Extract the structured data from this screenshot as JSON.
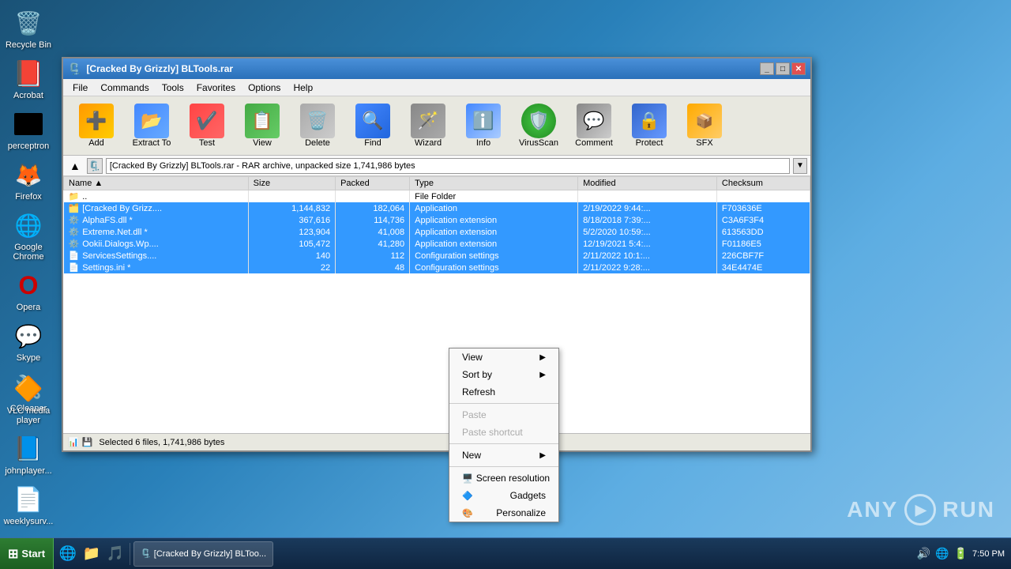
{
  "desktop": {
    "icons": [
      {
        "id": "recycle-bin",
        "label": "Recycle Bin",
        "icon": "🗑️"
      },
      {
        "id": "acrobat",
        "label": "Acrobat",
        "icon": "📄"
      },
      {
        "id": "black-box",
        "label": "perceptron",
        "icon": ""
      },
      {
        "id": "firefox",
        "label": "Firefox",
        "icon": "🦊"
      },
      {
        "id": "chrome",
        "label": "Google Chrome",
        "icon": "🌐"
      },
      {
        "id": "opera",
        "label": "Opera",
        "icon": "O"
      },
      {
        "id": "skype",
        "label": "Skype",
        "icon": "💬"
      },
      {
        "id": "ccleaner",
        "label": "CCleaner",
        "icon": "🔧"
      }
    ],
    "bottom_icons": [
      {
        "id": "vlc",
        "label": "VLC media player",
        "icon": "🔶"
      },
      {
        "id": "word1",
        "label": "johnplayer...",
        "icon": "📝"
      },
      {
        "id": "word2",
        "label": "weeklysurv...",
        "icon": "📄"
      }
    ]
  },
  "winrar": {
    "title": "[Cracked By Grizzly] BLTools.rar",
    "menu": [
      "File",
      "Commands",
      "Tools",
      "Favorites",
      "Options",
      "Help"
    ],
    "toolbar": [
      {
        "id": "add",
        "label": "Add"
      },
      {
        "id": "extract-to",
        "label": "Extract To"
      },
      {
        "id": "test",
        "label": "Test"
      },
      {
        "id": "view",
        "label": "View"
      },
      {
        "id": "delete",
        "label": "Delete"
      },
      {
        "id": "find",
        "label": "Find"
      },
      {
        "id": "wizard",
        "label": "Wizard"
      },
      {
        "id": "info",
        "label": "Info"
      },
      {
        "id": "virusscan",
        "label": "VirusScan"
      },
      {
        "id": "comment",
        "label": "Comment"
      },
      {
        "id": "protect",
        "label": "Protect"
      },
      {
        "id": "sfx",
        "label": "SFX"
      }
    ],
    "address": "[Cracked By Grizzly] BLTools.rar - RAR archive, unpacked size 1,741,986 bytes",
    "columns": [
      "Name",
      "Size",
      "Packed",
      "Type",
      "Modified",
      "Checksum"
    ],
    "files": [
      {
        "icon": "📁",
        "name": "..",
        "size": "",
        "packed": "",
        "type": "File Folder",
        "modified": "",
        "checksum": "",
        "selected": false
      },
      {
        "icon": "🗂️",
        "name": "[Cracked By Grizz....",
        "size": "1,144,832",
        "packed": "182,064",
        "type": "Application",
        "modified": "2/19/2022 9:44:...",
        "checksum": "F703636E",
        "selected": true
      },
      {
        "icon": "⚙️",
        "name": "AlphaFS.dll *",
        "size": "367,616",
        "packed": "114,736",
        "type": "Application extension",
        "modified": "8/18/2018 7:39:...",
        "checksum": "C3A6F3F4",
        "selected": true
      },
      {
        "icon": "⚙️",
        "name": "Extreme.Net.dll *",
        "size": "123,904",
        "packed": "41,008",
        "type": "Application extension",
        "modified": "5/2/2020 10:59:...",
        "checksum": "613563DD",
        "selected": true
      },
      {
        "icon": "⚙️",
        "name": "Ookii.Dialogs.Wp....",
        "size": "105,472",
        "packed": "41,280",
        "type": "Application extension",
        "modified": "12/19/2021 5:4:...",
        "checksum": "F01186E5",
        "selected": true
      },
      {
        "icon": "📄",
        "name": "ServicesSettings....",
        "size": "140",
        "packed": "112",
        "type": "Configuration settings",
        "modified": "2/11/2022 10:1:...",
        "checksum": "226CBF7F",
        "selected": true
      },
      {
        "icon": "📄",
        "name": "Settings.ini *",
        "size": "22",
        "packed": "48",
        "type": "Configuration settings",
        "modified": "2/11/2022 9:28:...",
        "checksum": "34E4474E",
        "selected": true
      }
    ],
    "status": "Selected 6 files, 1,741,986 bytes"
  },
  "context_menu": {
    "items": [
      {
        "id": "view",
        "label": "View",
        "has_arrow": true,
        "disabled": false
      },
      {
        "id": "sort-by",
        "label": "Sort by",
        "has_arrow": true,
        "disabled": false
      },
      {
        "id": "refresh",
        "label": "Refresh",
        "has_arrow": false,
        "disabled": false
      },
      {
        "separator": true
      },
      {
        "id": "paste",
        "label": "Paste",
        "has_arrow": false,
        "disabled": true
      },
      {
        "id": "paste-shortcut",
        "label": "Paste shortcut",
        "has_arrow": false,
        "disabled": true
      },
      {
        "separator": true
      },
      {
        "id": "new",
        "label": "New",
        "has_arrow": true,
        "disabled": false
      },
      {
        "separator": true
      },
      {
        "id": "screen-resolution",
        "label": "Screen resolution",
        "has_arrow": false,
        "disabled": false,
        "icon": "🖥️"
      },
      {
        "id": "gadgets",
        "label": "Gadgets",
        "has_arrow": false,
        "disabled": false,
        "icon": "🔷"
      },
      {
        "id": "personalize",
        "label": "Personalize",
        "has_arrow": false,
        "disabled": false,
        "icon": "🎨"
      }
    ]
  },
  "taskbar": {
    "start_label": "Start",
    "items": [
      {
        "id": "winrar-task",
        "label": "🗜️ [Cracked By Grizzly] BLToo..."
      }
    ],
    "tray_icons": [
      "🔊",
      "🌐",
      "🔋"
    ],
    "time": "7:50 PM"
  }
}
